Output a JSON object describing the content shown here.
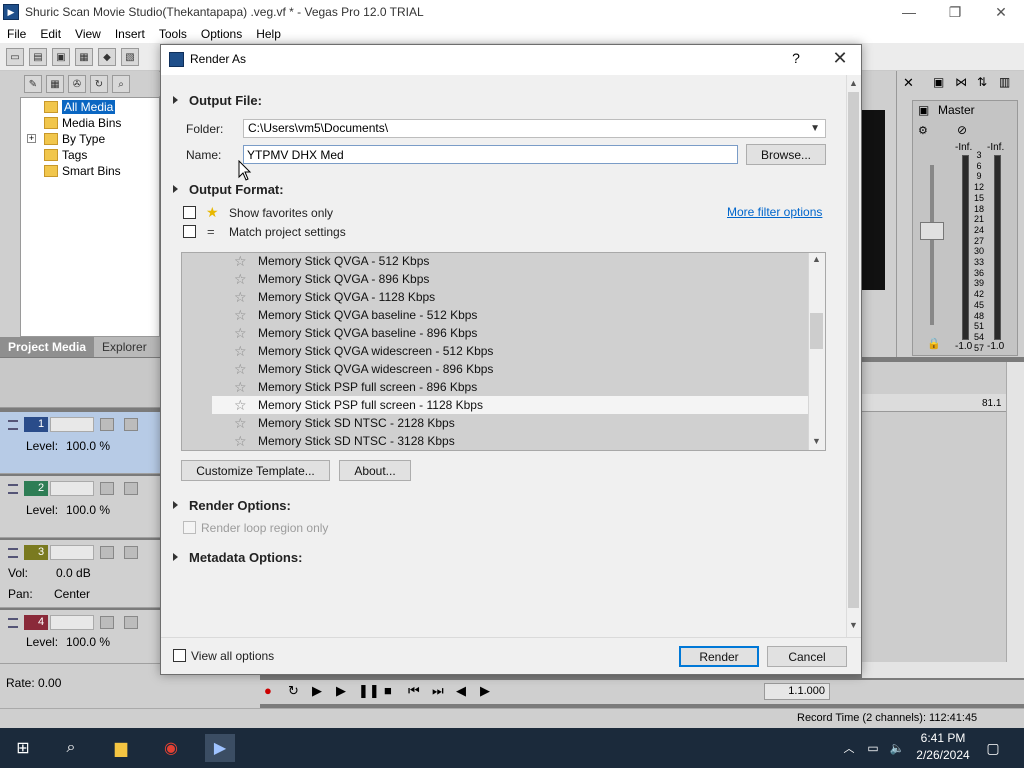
{
  "window": {
    "title": "Shuric Scan Movie Studio(Thekantapapa) .veg.vf * - Vegas Pro 12.0 TRIAL",
    "minimize": "—",
    "restore": "❐",
    "close": "✕"
  },
  "menu": [
    "File",
    "Edit",
    "View",
    "Insert",
    "Tools",
    "Options",
    "Help"
  ],
  "media_tree": {
    "items": [
      "All Media",
      "Media Bins",
      "By Type",
      "Tags",
      "Smart Bins"
    ],
    "expander": "+"
  },
  "media_tabs": [
    "Project Media",
    "Explorer"
  ],
  "tracks": [
    {
      "number": "1",
      "line1_label": "Level:",
      "line1_value": "100.0 %"
    },
    {
      "number": "2",
      "line1_label": "Level:",
      "line1_value": "100.0 %"
    },
    {
      "number": "3",
      "vol_label": "Vol:",
      "vol_value": "0.0 dB",
      "pan_label": "Pan:",
      "pan_value": "Center"
    },
    {
      "number": "4",
      "line1_label": "Level:",
      "line1_value": "100.0 %"
    }
  ],
  "rate": "Rate: 0.00",
  "timecode": "1.1.000",
  "ruler_label": "81.1",
  "status": {
    "record_time": "Record Time (2 channels): 112:41:45"
  },
  "mixer": {
    "title": "Master",
    "inf_left": "-Inf.",
    "inf_right": "-Inf.",
    "db_left": "-1.0",
    "db_right": "-1.0",
    "scale": [
      "3",
      "6",
      "9",
      "12",
      "15",
      "18",
      "21",
      "24",
      "27",
      "30",
      "33",
      "36",
      "39",
      "42",
      "45",
      "48",
      "51",
      "54",
      "57"
    ]
  },
  "taskbar": {
    "time": "6:41 PM",
    "date": "2/26/2024"
  },
  "dialog": {
    "title": "Render As",
    "help": "?",
    "close": "✕",
    "output_file": {
      "title": "Output File:",
      "folder_label": "Folder:",
      "folder_value": "C:\\Users\\vm5\\Documents\\",
      "name_label": "Name:",
      "name_value": "YTPMV DHX Med",
      "browse": "Browse..."
    },
    "output_format": {
      "title": "Output Format:",
      "show_favorites": "Show favorites only",
      "match_project": "Match project settings",
      "more_filter": "More filter options"
    },
    "templates": [
      "Memory Stick QVGA - 512 Kbps",
      "Memory Stick QVGA - 896 Kbps",
      "Memory Stick QVGA - 1128 Kbps",
      "Memory Stick QVGA baseline - 512 Kbps",
      "Memory Stick QVGA baseline - 896 Kbps",
      "Memory Stick QVGA widescreen - 512 Kbps",
      "Memory Stick QVGA widescreen - 896 Kbps",
      "Memory Stick PSP full screen - 896 Kbps",
      "Memory Stick PSP full screen - 1128 Kbps",
      "Memory Stick SD NTSC - 2128 Kbps",
      "Memory Stick SD NTSC - 3128 Kbps"
    ],
    "selected_template_index": 8,
    "customize": "Customize Template...",
    "about": "About...",
    "render_options": {
      "title": "Render Options:",
      "loop_region": "Render loop region only"
    },
    "metadata_options": {
      "title": "Metadata Options:"
    },
    "view_all": "View all options",
    "render": "Render",
    "cancel": "Cancel"
  }
}
